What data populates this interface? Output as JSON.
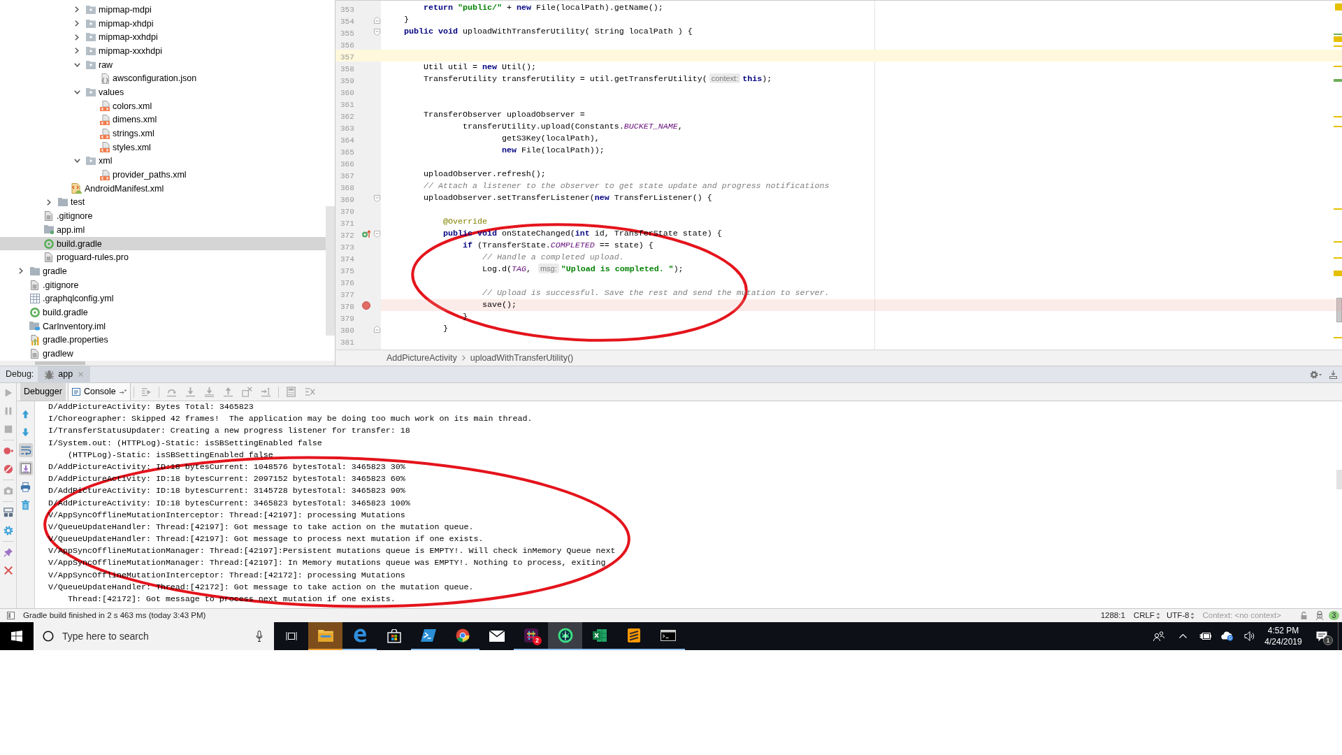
{
  "project_tree": {
    "items": [
      {
        "children": [
          {
            "children": [
              {
                "children": [
                  {
                    "children": [
                      {
                        "label": "mipmap-mdpi",
                        "kind": "resfolder",
                        "expanded": false,
                        "selected": false
                      },
                      {
                        "label": "mipmap-xhdpi",
                        "kind": "resfolder",
                        "expanded": false,
                        "selected": false
                      },
                      {
                        "label": "mipmap-xxhdpi",
                        "kind": "resfolder",
                        "expanded": false,
                        "selected": false
                      },
                      {
                        "label": "mipmap-xxxhdpi",
                        "kind": "resfolder",
                        "expanded": false,
                        "selected": false
                      },
                      {
                        "label": "raw",
                        "kind": "resfolder",
                        "expanded": true,
                        "selected": false,
                        "children": [
                          {
                            "label": "awsconfiguration.json",
                            "kind": "json",
                            "selected": false
                          }
                        ]
                      },
                      {
                        "label": "values",
                        "kind": "resfolder",
                        "expanded": true,
                        "selected": false,
                        "children": [
                          {
                            "label": "colors.xml",
                            "kind": "xml",
                            "selected": false
                          },
                          {
                            "label": "dimens.xml",
                            "kind": "xml",
                            "selected": false
                          },
                          {
                            "label": "strings.xml",
                            "kind": "xml",
                            "selected": false
                          },
                          {
                            "label": "styles.xml",
                            "kind": "xml",
                            "selected": false
                          }
                        ]
                      },
                      {
                        "label": "xml",
                        "kind": "resfolder",
                        "expanded": true,
                        "selected": false,
                        "children": [
                          {
                            "label": "provider_paths.xml",
                            "kind": "xml",
                            "selected": false
                          }
                        ]
                      }
                    ]
                  },
                  {
                    "label": "AndroidManifest.xml",
                    "kind": "manifest",
                    "selected": false
                  }
                ]
              },
              {
                "label": "test",
                "kind": "folder",
                "expanded": false,
                "selected": false
              }
            ]
          },
          {
            "label": ".gitignore",
            "kind": "text",
            "selected": false
          },
          {
            "label": "app.iml",
            "kind": "module",
            "selected": false
          },
          {
            "label": "build.gradle",
            "kind": "gradle",
            "selected": true
          },
          {
            "label": "proguard-rules.pro",
            "kind": "text",
            "selected": false
          }
        ]
      },
      {
        "label": "gradle",
        "kind": "folder",
        "expanded": false,
        "selected": false
      },
      {
        "label": ".gitignore",
        "kind": "text",
        "selected": false
      },
      {
        "label": ".graphqlconfig.yml",
        "kind": "table",
        "selected": false
      },
      {
        "label": "build.gradle",
        "kind": "gradle",
        "selected": false
      },
      {
        "label": "CarInventory.iml",
        "kind": "project",
        "selected": false
      },
      {
        "label": "gradle.properties",
        "kind": "properties",
        "selected": false
      },
      {
        "label": "gradlew",
        "kind": "text",
        "selected": false
      }
    ]
  },
  "editor": {
    "circled": true,
    "lines": [
      {
        "number": "353",
        "current": false,
        "breakpoint": false,
        "segments": [
          {
            "kind": "keyword",
            "text": "        return"
          },
          {
            "kind": "string",
            "text": " \"public/\""
          },
          {
            "kind": "plain",
            "text": " + "
          },
          {
            "kind": "keyword",
            "text": "new"
          },
          {
            "kind": "plain",
            "text": " File(localPath).getName();"
          }
        ]
      },
      {
        "number": "354",
        "current": false,
        "breakpoint": false,
        "gutter_marks": [
          {
            "kind": "foldend"
          }
        ],
        "segments": [
          {
            "kind": "plain",
            "text": "    }"
          }
        ]
      },
      {
        "number": "355",
        "current": false,
        "breakpoint": false,
        "gutter_marks": [
          {
            "kind": "foldstart"
          }
        ],
        "segments": [
          {
            "kind": "keyword",
            "text": "    public void"
          },
          {
            "kind": "plain",
            "text": " uploadWithTransferUtility( String localPath ) {"
          }
        ]
      },
      {
        "number": "356",
        "current": false,
        "breakpoint": false
      },
      {
        "number": "357",
        "current": true,
        "breakpoint": false
      },
      {
        "number": "358",
        "current": false,
        "breakpoint": false,
        "segments": [
          {
            "kind": "plain",
            "text": "        Util util = "
          },
          {
            "kind": "keyword",
            "text": "new"
          },
          {
            "kind": "plain",
            "text": " Util();"
          }
        ]
      },
      {
        "number": "359",
        "current": false,
        "breakpoint": false,
        "segments": [
          {
            "kind": "plain",
            "text": "        TransferUtility transferUtility = util.getTransferUtility("
          },
          {
            "kind": "hint",
            "text": "context:"
          },
          {
            "kind": "keyword",
            "text": "this"
          },
          {
            "kind": "plain",
            "text": ");"
          }
        ]
      },
      {
        "number": "360",
        "current": false,
        "breakpoint": false
      },
      {
        "number": "361",
        "current": false,
        "breakpoint": false
      },
      {
        "number": "362",
        "current": false,
        "breakpoint": false,
        "segments": [
          {
            "kind": "plain",
            "text": "        TransferObserver uploadObserver ="
          }
        ]
      },
      {
        "number": "363",
        "current": false,
        "breakpoint": false,
        "segments": [
          {
            "kind": "plain",
            "text": "                transferUtility.upload(Constants."
          },
          {
            "kind": "constant",
            "text": "BUCKET_NAME"
          },
          {
            "kind": "plain",
            "text": ","
          }
        ]
      },
      {
        "number": "364",
        "current": false,
        "breakpoint": false,
        "segments": [
          {
            "kind": "plain",
            "text": "                        getS3Key(localPath),"
          }
        ]
      },
      {
        "number": "365",
        "current": false,
        "breakpoint": false,
        "segments": [
          {
            "kind": "keyword",
            "text": "                        new"
          },
          {
            "kind": "plain",
            "text": " File(localPath));"
          }
        ]
      },
      {
        "number": "366",
        "current": false,
        "breakpoint": false
      },
      {
        "number": "367",
        "current": false,
        "breakpoint": false,
        "segments": [
          {
            "kind": "plain",
            "text": "        uploadObserver.refresh();"
          }
        ]
      },
      {
        "number": "368",
        "current": false,
        "breakpoint": false,
        "segments": [
          {
            "kind": "comment",
            "text": "        // Attach a listener to the observer to get state update and progress notifications"
          }
        ]
      },
      {
        "number": "369",
        "current": false,
        "breakpoint": false,
        "gutter_marks": [
          {
            "kind": "foldstart"
          }
        ],
        "segments": [
          {
            "kind": "plain",
            "text": "        uploadObserver.setTransferListener("
          },
          {
            "kind": "keyword",
            "text": "new"
          },
          {
            "kind": "plain",
            "text": " TransferListener() {"
          }
        ]
      },
      {
        "number": "370",
        "current": false,
        "breakpoint": false
      },
      {
        "number": "371",
        "current": false,
        "breakpoint": false,
        "segments": [
          {
            "kind": "annotation",
            "text": "            @Override"
          }
        ]
      },
      {
        "number": "372",
        "current": false,
        "breakpoint": false,
        "gutter_marks": [
          {
            "kind": "override"
          },
          {
            "kind": "foldstart"
          }
        ],
        "segments": [
          {
            "kind": "keyword",
            "text": "            public void"
          },
          {
            "kind": "plain",
            "text": " onStateChanged("
          },
          {
            "kind": "keyword",
            "text": "int"
          },
          {
            "kind": "plain",
            "text": " id, TransferState state) {"
          }
        ]
      },
      {
        "number": "373",
        "current": false,
        "breakpoint": false,
        "segments": [
          {
            "kind": "keyword",
            "text": "                if"
          },
          {
            "kind": "plain",
            "text": " (TransferState."
          },
          {
            "kind": "constant",
            "text": "COMPLETED"
          },
          {
            "kind": "plain",
            "text": " == state) {"
          }
        ]
      },
      {
        "number": "374",
        "current": false,
        "breakpoint": false,
        "segments": [
          {
            "kind": "comment",
            "text": "                    // Handle a completed upload."
          }
        ]
      },
      {
        "number": "375",
        "current": false,
        "breakpoint": false,
        "segments": [
          {
            "kind": "plain",
            "text": "                    Log.d("
          },
          {
            "kind": "constant",
            "text": "TAG"
          },
          {
            "kind": "plain",
            "text": ", "
          },
          {
            "kind": "hint",
            "text": "msg:"
          },
          {
            "kind": "string",
            "text": "\"Upload is completed. \""
          },
          {
            "kind": "plain",
            "text": ");"
          }
        ]
      },
      {
        "number": "376",
        "current": false,
        "breakpoint": false
      },
      {
        "number": "377",
        "current": false,
        "breakpoint": false,
        "segments": [
          {
            "kind": "comment",
            "text": "                    // Upload is successful. Save the rest and send the mutation to server."
          }
        ]
      },
      {
        "number": "378",
        "current": false,
        "breakpoint": true,
        "segments": [
          {
            "kind": "plain",
            "text": "                    save();"
          }
        ]
      },
      {
        "number": "379",
        "current": false,
        "breakpoint": false,
        "segments": [
          {
            "kind": "plain",
            "text": "                }"
          }
        ]
      },
      {
        "number": "380",
        "current": false,
        "breakpoint": false,
        "gutter_marks": [
          {
            "kind": "foldend"
          }
        ],
        "segments": [
          {
            "kind": "plain",
            "text": "            }"
          }
        ]
      },
      {
        "number": "381",
        "current": false,
        "breakpoint": false
      }
    ],
    "breadcrumbs": [
      "AddPictureActivity",
      "uploadWithTransferUtility()"
    ]
  },
  "debug": {
    "title": "Debug:",
    "tabs": [
      {
        "label": "app",
        "selected": true
      }
    ],
    "side_buttons": [
      {
        "kind": "resume",
        "disabled": true
      },
      {
        "kind": "pause",
        "disabled": true
      },
      {
        "kind": "stop",
        "disabled": true
      },
      {
        "kind": "breakpoints",
        "disabled": false
      },
      {
        "kind": "mute",
        "disabled": false
      },
      {
        "kind": "snapshot",
        "disabled": true
      },
      {
        "kind": "layout",
        "disabled": false
      },
      {
        "kind": "settings",
        "disabled": false
      },
      {
        "kind": "pin",
        "disabled": false
      },
      {
        "kind": "close",
        "disabled": false
      }
    ],
    "subtabs": [
      {
        "label": "Debugger",
        "selected": false
      },
      {
        "label": "Console",
        "selected": true
      }
    ],
    "toolbar_buttons": [
      {
        "kind": "execution",
        "disabled": true
      },
      {
        "kind": "stepover",
        "disabled": true
      },
      {
        "kind": "stepinto",
        "disabled": true
      },
      {
        "kind": "forcestep",
        "disabled": true
      },
      {
        "kind": "stepout",
        "disabled": true
      },
      {
        "kind": "dropframe",
        "disabled": true
      },
      {
        "kind": "cursor",
        "disabled": true
      },
      {
        "kind": "evaluate",
        "disabled": true
      },
      {
        "kind": "trace",
        "disabled": true
      }
    ],
    "console_buttons": [
      {
        "kind": "up",
        "on": false
      },
      {
        "kind": "down",
        "on": false
      },
      {
        "kind": "wrap",
        "on": true
      },
      {
        "kind": "scrollend",
        "on": true
      },
      {
        "kind": "print",
        "on": false
      },
      {
        "kind": "clear",
        "on": false
      }
    ],
    "console": {
      "circled": true,
      "lines": [
        "D/AddPictureActivity: Bytes Total: 3465823",
        "I/Choreographer: Skipped 42 frames!  The application may be doing too much work on its main thread.",
        "I/TransferStatusUpdater: Creating a new progress listener for transfer: 18",
        "I/System.out: (HTTPLog)-Static: isSBSettingEnabled false",
        "    (HTTPLog)-Static: isSBSettingEnabled false",
        "D/AddPictureActivity: ID:18 bytesCurrent: 1048576 bytesTotal: 3465823 30%",
        "D/AddPictureActivity: ID:18 bytesCurrent: 2097152 bytesTotal: 3465823 60%",
        "D/AddPictureActivity: ID:18 bytesCurrent: 3145728 bytesTotal: 3465823 90%",
        "D/AddPictureActivity: ID:18 bytesCurrent: 3465823 bytesTotal: 3465823 100%",
        "V/AppSyncOfflineMutationInterceptor: Thread:[42197]: processing Mutations",
        "V/QueueUpdateHandler: Thread:[42197]: Got message to take action on the mutation queue.",
        "V/QueueUpdateHandler: Thread:[42197]: Got message to process next mutation if one exists.",
        "V/AppSyncOfflineMutationManager: Thread:[42197]:Persistent mutations queue is EMPTY!. Will check inMemory Queue next",
        "V/AppSyncOfflineMutationManager: Thread:[42197]: In Memory mutations queue was EMPTY!. Nothing to process, exiting",
        "V/AppSyncOfflineMutationInterceptor: Thread:[42172]: processing Mutations",
        "V/QueueUpdateHandler: Thread:[42172]: Got message to take action on the mutation queue.",
        "    Thread:[42172]: Got message to process next mutation if one exists."
      ]
    }
  },
  "status_bar": {
    "message": "Gradle build finished in 2 s 463 ms (today 3:43 PM)",
    "position": "1288:1",
    "line_separator": "CRLF",
    "encoding": "UTF-8",
    "context": "Context: <no context>",
    "event_count": "3"
  },
  "taskbar": {
    "search": {
      "placeholder": "Type here to search"
    },
    "apps": [
      {
        "kind": "files",
        "running": true,
        "active": false,
        "attention": true
      },
      {
        "kind": "web",
        "running": true,
        "active": false,
        "attention": false
      },
      {
        "kind": "store",
        "running": false,
        "active": false,
        "attention": false
      },
      {
        "kind": "shell",
        "running": true,
        "active": false,
        "attention": false
      },
      {
        "kind": "globe",
        "running": true,
        "active": false,
        "attention": false
      },
      {
        "kind": "mail",
        "running": false,
        "active": false,
        "attention": false
      },
      {
        "kind": "chat",
        "running": true,
        "active": false,
        "attention": false,
        "badge": "2"
      },
      {
        "kind": "studio",
        "running": true,
        "active": true,
        "attention": false
      },
      {
        "kind": "sheet",
        "running": true,
        "active": false,
        "attention": false
      },
      {
        "kind": "editor",
        "running": true,
        "active": false,
        "attention": false
      },
      {
        "kind": "terminal",
        "running": true,
        "active": false,
        "attention": false
      }
    ],
    "clock": {
      "time": "4:52 PM",
      "date": "4/24/2019"
    },
    "notification_count": "1"
  }
}
